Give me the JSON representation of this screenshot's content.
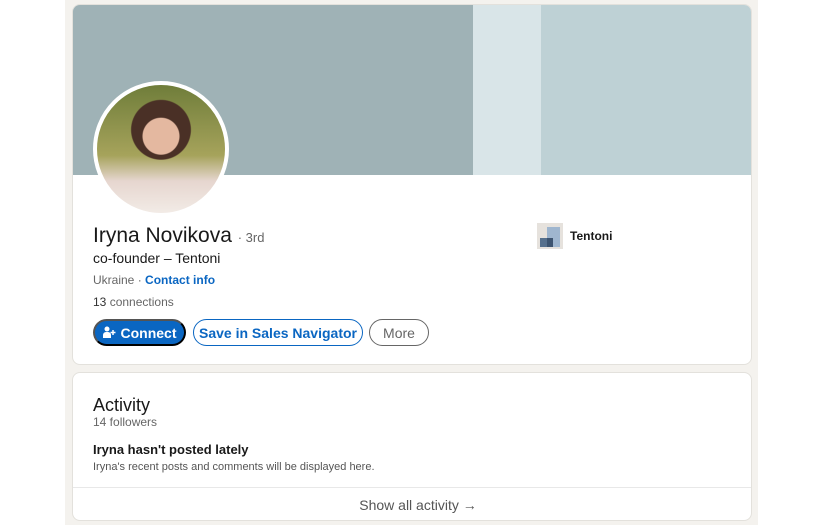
{
  "profile": {
    "name": "Iryna Novikova",
    "degree": "· 3rd",
    "headline": "co-founder – Tentoni",
    "location": "Ukraine",
    "location_sep": " · ",
    "contact_info": "Contact info",
    "connections_count": "13",
    "connections_label": " connections",
    "company": "Tentoni"
  },
  "actions": {
    "connect": "Connect",
    "sales_navigator": "Save in Sales Navigator",
    "more": "More"
  },
  "activity": {
    "title": "Activity",
    "followers": "14 followers",
    "empty_title": "Iryna hasn't posted lately",
    "empty_text": "Iryna's recent posts and comments will be displayed here.",
    "show_all": "Show all activity →"
  },
  "colors": {
    "accent": "#0a66c2",
    "banner": "#bed1d5"
  }
}
